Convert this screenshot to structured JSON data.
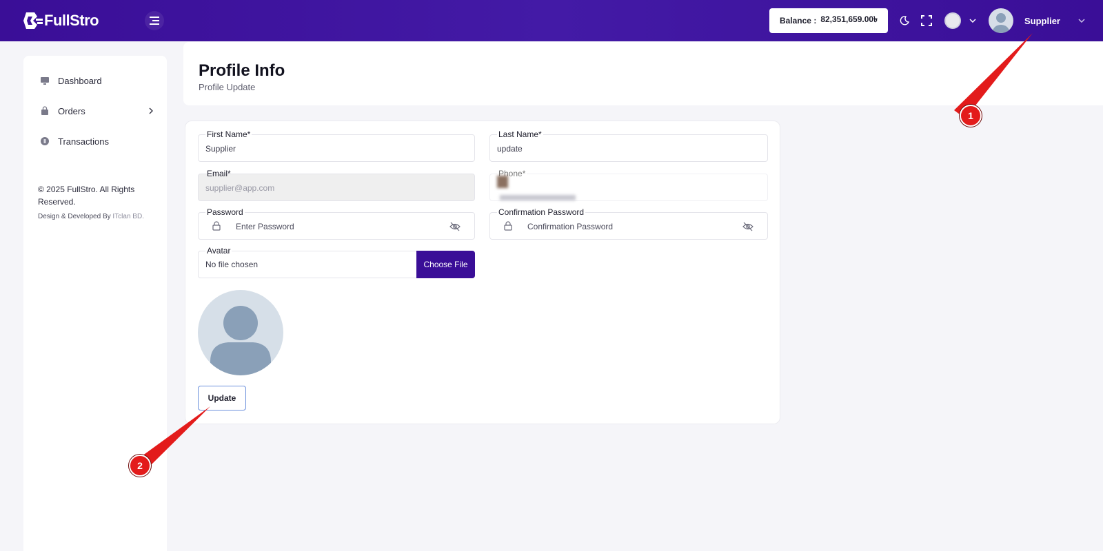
{
  "header": {
    "brand": "FullStro",
    "balance_label": "Balance :",
    "balance_value": "82,351,659.00৳",
    "user_name": "Supplier"
  },
  "sidebar": {
    "items": [
      {
        "label": "Dashboard",
        "icon": "monitor-icon"
      },
      {
        "label": "Orders",
        "icon": "bag-icon"
      },
      {
        "label": "Transactions",
        "icon": "coin-icon"
      }
    ],
    "copyright": "© 2025 FullStro. All Rights Reserved.",
    "designed_prefix": "Design & Developed By",
    "designed_company": "ITclan BD."
  },
  "page": {
    "title": "Profile Info",
    "subtitle": "Profile Update"
  },
  "form": {
    "first_name": {
      "label": "First Name*",
      "value": "Supplier"
    },
    "last_name": {
      "label": "Last Name*",
      "value": "update"
    },
    "email": {
      "label": "Email*",
      "value": "supplier@app.com"
    },
    "phone": {
      "label": "Phone*"
    },
    "password": {
      "label": "Password",
      "placeholder": "Enter Password"
    },
    "confirm_password": {
      "label": "Confirmation Password",
      "placeholder": "Confirmation Password"
    },
    "avatar": {
      "label": "Avatar",
      "file_status": "No file chosen",
      "choose_label": "Choose File"
    },
    "update_label": "Update"
  },
  "annotations": [
    "1",
    "2"
  ],
  "colors": {
    "brand_purple": "#3a0e97",
    "callout_red": "#e31b1b"
  }
}
